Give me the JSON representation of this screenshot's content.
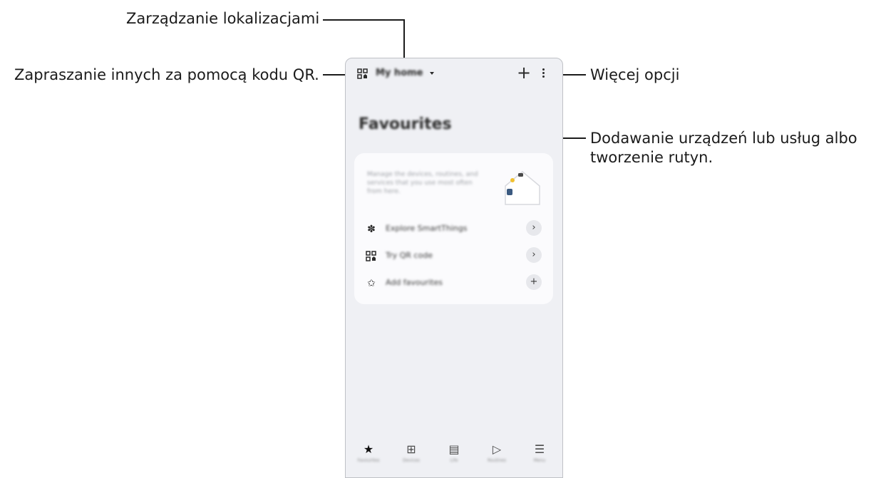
{
  "annotations": {
    "locations": "Zarządzanie lokalizacjami",
    "invite_qr": "Zapraszanie innych za pomocą kodu QR.",
    "more_options": "Więcej opcji",
    "add_line1": "Dodawanie urządzeń lub usług albo",
    "add_line2": "tworzenie rutyn."
  },
  "app": {
    "location_label": "My home",
    "page_title": "Favourites",
    "card_text": "Manage the devices, routines, and services that you use most often from here.",
    "rows": [
      {
        "label": "Explore SmartThings",
        "icon": "fan-icon",
        "action": "›"
      },
      {
        "label": "Try QR code",
        "icon": "qr-home-icon",
        "action": "›"
      },
      {
        "label": "Add favourites",
        "icon": "star-icon",
        "action": "+"
      }
    ],
    "nav": [
      {
        "label": "Favourites",
        "icon": "★"
      },
      {
        "label": "Devices",
        "icon": "⊞"
      },
      {
        "label": "Life",
        "icon": "▤"
      },
      {
        "label": "Routines",
        "icon": "▷"
      },
      {
        "label": "Menu",
        "icon": "☰"
      }
    ]
  },
  "colors": {
    "accent": "#111111",
    "phone_bg": "#eff0f4",
    "card_bg": "#fbfbfd"
  }
}
